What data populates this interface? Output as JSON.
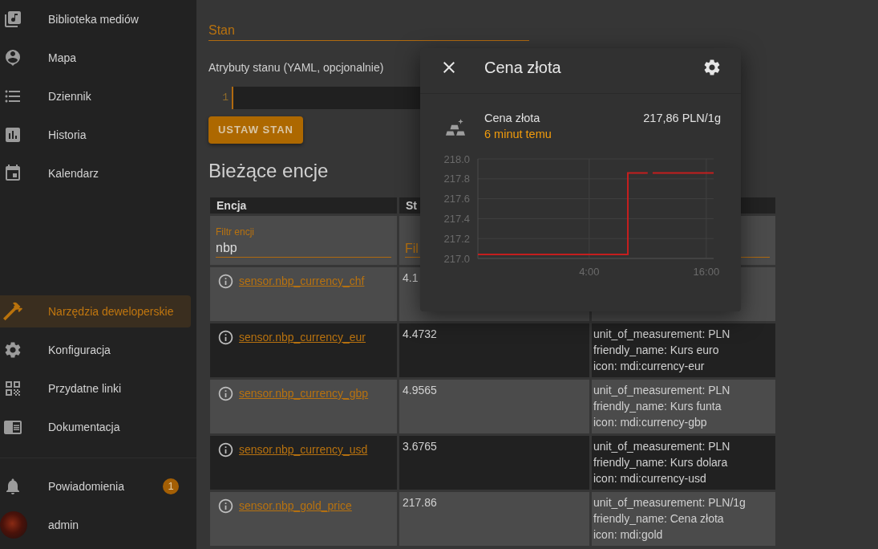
{
  "sidebar": {
    "items": [
      {
        "label": "Biblioteka mediów",
        "selected": false
      },
      {
        "label": "Mapa",
        "selected": false
      },
      {
        "label": "Dziennik",
        "selected": false
      },
      {
        "label": "Historia",
        "selected": false
      },
      {
        "label": "Kalendarz",
        "selected": false
      }
    ],
    "footer_items": [
      {
        "label": "Narzędzia deweloperskie",
        "selected": true
      },
      {
        "label": "Konfiguracja",
        "selected": false
      },
      {
        "label": "Przydatne linki",
        "selected": false
      },
      {
        "label": "Dokumentacja",
        "selected": false
      }
    ],
    "notifications": {
      "label": "Powiadomienia",
      "badge": "1"
    },
    "user": {
      "label": "admin"
    }
  },
  "state_form": {
    "state_input": {
      "placeholder": "Stan"
    },
    "attributes_label": "Atrybuty stanu (YAML, opcjonalnie)",
    "editor": {
      "line_numbers": [
        "1"
      ]
    },
    "button": "USTAW STAN"
  },
  "entities": {
    "heading": "Bieżące encje",
    "columns": [
      "Encja",
      "St"
    ],
    "filters": [
      {
        "label": "Filtr encji",
        "value": "nbp"
      },
      {
        "placeholder": "Fil"
      }
    ],
    "rows": [
      {
        "entity": "sensor.nbp_currency_chf",
        "state": "4.1"
      },
      {
        "entity": "sensor.nbp_currency_eur",
        "state": "4.4732",
        "attributes": [
          "unit_of_measurement: PLN",
          "friendly_name: Kurs euro",
          "icon: mdi:currency-eur"
        ]
      },
      {
        "entity": "sensor.nbp_currency_gbp",
        "state": "4.9565",
        "attributes": [
          "unit_of_measurement: PLN",
          "friendly_name: Kurs funta",
          "icon: mdi:currency-gbp"
        ]
      },
      {
        "entity": "sensor.nbp_currency_usd",
        "state": "3.6765",
        "attributes": [
          "unit_of_measurement: PLN",
          "friendly_name: Kurs dolara",
          "icon: mdi:currency-usd"
        ]
      },
      {
        "entity": "sensor.nbp_gold_price",
        "state": "217.86",
        "attributes": [
          "unit_of_measurement: PLN/1g",
          "friendly_name: Cena złota",
          "icon: mdi:gold"
        ]
      }
    ]
  },
  "dialog": {
    "title": "Cena złota",
    "entity": {
      "name": "Cena złota",
      "last_changed": "6 minut temu",
      "state": "217,86 PLN/1g"
    },
    "chart_data": {
      "type": "line",
      "grid": true,
      "x": [
        -7.4,
        7.96,
        7.96,
        10.0,
        10.25,
        10.5,
        16.75
      ],
      "series": [
        {
          "color": "#c41e1e",
          "values": [
            217.04,
            217.04,
            217.86,
            217.86,
            null,
            217.86,
            217.86
          ]
        }
      ],
      "xlim": [
        -7.4,
        16.75
      ],
      "ylim": [
        217,
        218
      ],
      "xticks": [
        {
          "value": 4,
          "label": "4:00"
        },
        {
          "value": 16,
          "label": "16:00"
        }
      ],
      "yticks": [
        {
          "value": 217,
          "label": "217.0"
        },
        {
          "value": 217.2,
          "label": "217.2"
        },
        {
          "value": 217.4,
          "label": "217.4"
        },
        {
          "value": 217.6,
          "label": "217.6"
        },
        {
          "value": 217.8,
          "label": "217.8"
        },
        {
          "value": 218,
          "label": "218.0"
        }
      ]
    }
  }
}
